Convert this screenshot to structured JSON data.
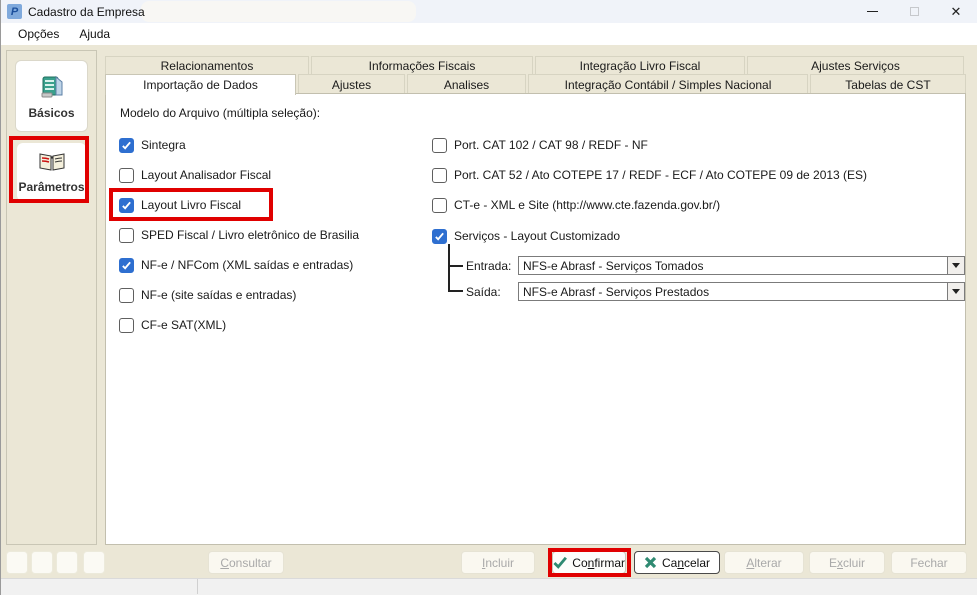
{
  "window": {
    "title": "Cadastro da Empresa"
  },
  "menu": {
    "items": [
      {
        "label": "Opções"
      },
      {
        "label": "Ajuda"
      }
    ]
  },
  "sidebar": {
    "buttons": [
      {
        "label": "Básicos",
        "icon": "card-file-icon",
        "highlighted": false
      },
      {
        "label": "Parâmetros",
        "icon": "open-book-icon",
        "highlighted": true
      }
    ]
  },
  "tabs": {
    "row1": [
      {
        "label": "Relacionamentos"
      },
      {
        "label": "Informações Fiscais"
      },
      {
        "label": "Integração Livro Fiscal"
      },
      {
        "label": "Ajustes Serviços"
      }
    ],
    "row2": [
      {
        "label": "Importação de Dados",
        "active": true
      },
      {
        "label": "Ajustes",
        "active": false
      },
      {
        "label": "Analises",
        "active": false
      },
      {
        "label": "Integração Contábil / Simples Nacional",
        "active": false
      },
      {
        "label": "Tabelas de CST",
        "active": false
      }
    ]
  },
  "content": {
    "section_label": "Modelo do Arquivo (múltipla seleção):",
    "left_checkboxes": [
      {
        "label": "Sintegra",
        "checked": true,
        "highlighted": false
      },
      {
        "label": "Layout Analisador Fiscal",
        "checked": false,
        "highlighted": false
      },
      {
        "label": "Layout Livro Fiscal",
        "checked": true,
        "highlighted": true
      },
      {
        "label": "SPED Fiscal / Livro eletrônico de Brasilia",
        "checked": false,
        "highlighted": false
      },
      {
        "label": "NF-e / NFCom (XML saídas e entradas)",
        "checked": true,
        "highlighted": false
      },
      {
        "label": "NF-e (site saídas e entradas)",
        "checked": false,
        "highlighted": false
      },
      {
        "label": "CF-e SAT(XML)",
        "checked": false,
        "highlighted": false
      }
    ],
    "right_checkboxes": [
      {
        "label": "Port. CAT 102 / CAT 98 / REDF - NF",
        "checked": false
      },
      {
        "label": "Port. CAT 52 / Ato COTEPE 17 / REDF - ECF / Ato COTEPE 09 de 2013 (ES)",
        "checked": false
      },
      {
        "label": "CT-e - XML e Site (http://www.cte.fazenda.gov.br/)",
        "checked": false
      },
      {
        "label": "Serviços - Layout Customizado",
        "checked": true
      }
    ],
    "entrada": {
      "label": "Entrada:",
      "value": "NFS-e Abrasf - Serviços Tomados"
    },
    "saida": {
      "label": "Saída:",
      "value": "NFS-e Abrasf - Serviços Prestados"
    }
  },
  "footer": {
    "buttons": [
      {
        "name": "consultar",
        "pre": "",
        "key": "C",
        "post": "onsultar",
        "disabled": true
      },
      {
        "name": "incluir",
        "pre": "",
        "key": "I",
        "post": "ncluir",
        "disabled": true
      },
      {
        "name": "confirmar",
        "pre": "Co",
        "key": "n",
        "post": "firmar",
        "disabled": false,
        "icon": "check-icon",
        "highlighted": true
      },
      {
        "name": "cancelar",
        "pre": "Ca",
        "key": "n",
        "post": "celar",
        "disabled": false,
        "icon": "x-icon"
      },
      {
        "name": "alterar",
        "pre": "",
        "key": "A",
        "post": "lterar",
        "disabled": true
      },
      {
        "name": "excluir",
        "pre": "E",
        "key": "x",
        "post": "cluir",
        "disabled": true
      },
      {
        "name": "fechar",
        "pre": "Fechar",
        "key": "",
        "post": "",
        "disabled": true
      }
    ]
  },
  "titlebar": {
    "close_glyph": "✕"
  },
  "colors": {
    "background_beige": "#ebe7d6",
    "checkbox_accent": "#2e6fd0",
    "annotation_red": "#e00000",
    "button_icon_teal": "#2f8a72",
    "titlebar_bg": "#f0f3f9"
  }
}
